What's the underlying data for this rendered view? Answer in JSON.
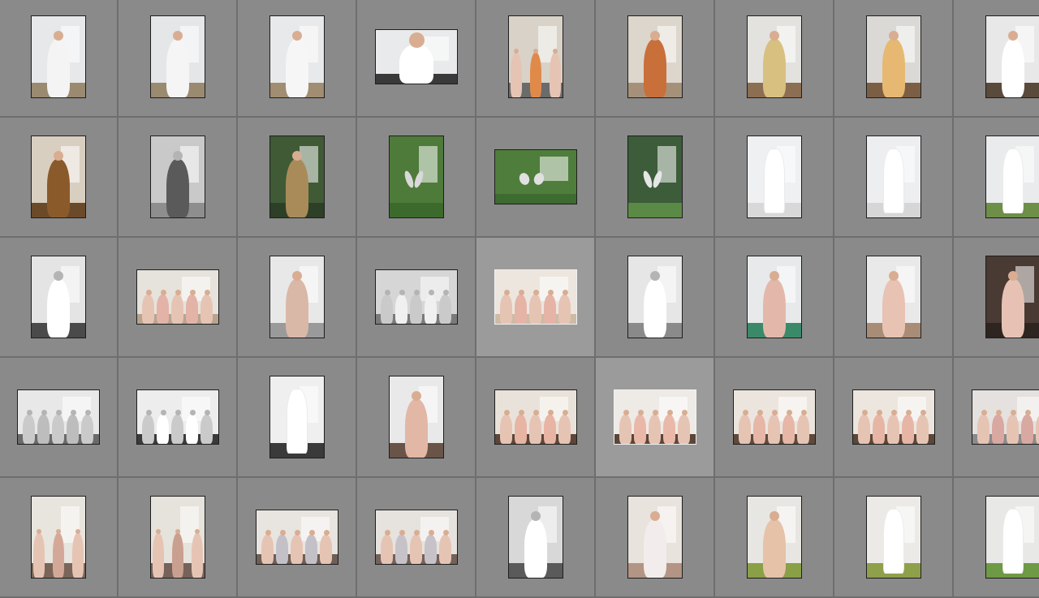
{
  "grid": {
    "rows": 5,
    "columns": 9,
    "selected": [
      [
        2,
        4
      ],
      [
        3,
        5
      ]
    ],
    "thumbnails": [
      [
        {
          "orient": "portrait",
          "bg": "#e6e8ea",
          "accent": "#f4f4f4",
          "floor": "#9a8a70",
          "tone": "color",
          "figure": "groom"
        },
        {
          "orient": "portrait",
          "bg": "#e4e6e8",
          "accent": "#f5f5f5",
          "floor": "#9a8a70",
          "tone": "color",
          "figure": "groom"
        },
        {
          "orient": "portrait",
          "bg": "#e8e9eb",
          "accent": "#f6f6f6",
          "floor": "#a08d72",
          "tone": "color",
          "figure": "groom"
        },
        {
          "orient": "landscape",
          "bg": "#e9eaec",
          "accent": "#ffffff",
          "floor": "#3a3a3a",
          "tone": "color",
          "figure": "groom"
        },
        {
          "orient": "portrait",
          "bg": "#d8d2c8",
          "accent": "#e08a4a",
          "floor": "#6b6b6b",
          "tone": "color",
          "figure": "group"
        },
        {
          "orient": "portrait",
          "bg": "#dcd6cc",
          "accent": "#c96f3a",
          "floor": "#a5917a",
          "tone": "color",
          "figure": "groom"
        },
        {
          "orient": "portrait",
          "bg": "#e3e2de",
          "accent": "#d8c080",
          "floor": "#8c6e52",
          "tone": "color",
          "figure": "groom"
        },
        {
          "orient": "portrait",
          "bg": "#dad9d6",
          "accent": "#e6b872",
          "floor": "#7c5e44",
          "tone": "color",
          "figure": "groom"
        },
        {
          "orient": "portrait",
          "bg": "#e8e8e8",
          "accent": "#ffffff",
          "floor": "#5a4a3c",
          "tone": "color",
          "figure": "groom"
        }
      ],
      [
        {
          "orient": "portrait",
          "bg": "#d9cfc0",
          "accent": "#8b5a2b",
          "floor": "#6b4a2a",
          "tone": "color",
          "figure": "groom"
        },
        {
          "orient": "portrait",
          "bg": "#c9c9c9",
          "accent": "#5a5a5a",
          "floor": "#8e8e8e",
          "tone": "bw",
          "figure": "groom"
        },
        {
          "orient": "portrait",
          "bg": "#3f5a35",
          "accent": "#a98b5a",
          "floor": "#2d3f26",
          "tone": "color",
          "figure": "groom"
        },
        {
          "orient": "portrait",
          "bg": "#4e7a3a",
          "accent": "#d9d9d9",
          "floor": "#3c6a2c",
          "tone": "color",
          "figure": "shoes"
        },
        {
          "orient": "landscape",
          "bg": "#4f7d3c",
          "accent": "#e0e0e0",
          "floor": "#3e6b2f",
          "tone": "color",
          "figure": "shoes"
        },
        {
          "orient": "portrait",
          "bg": "#3d5c3a",
          "accent": "#e6e6e6",
          "floor": "#5b8a46",
          "tone": "color",
          "figure": "shoes"
        },
        {
          "orient": "portrait",
          "bg": "#eef0f1",
          "accent": "#ffffff",
          "floor": "#d8d8d8",
          "tone": "color",
          "figure": "dress"
        },
        {
          "orient": "portrait",
          "bg": "#eceeef",
          "accent": "#ffffff",
          "floor": "#d6d6d6",
          "tone": "color",
          "figure": "dress"
        },
        {
          "orient": "portrait",
          "bg": "#e9ebec",
          "accent": "#ffffff",
          "floor": "#6d8f47",
          "tone": "color",
          "figure": "dress"
        }
      ],
      [
        {
          "orient": "portrait",
          "bg": "#e4e4e4",
          "accent": "#ffffff",
          "floor": "#4a4a4a",
          "tone": "bw",
          "figure": "bride"
        },
        {
          "orient": "landscape",
          "bg": "#e6e2dc",
          "accent": "#e3b3a8",
          "floor": "#b8a48e",
          "tone": "color",
          "figure": "group"
        },
        {
          "orient": "portrait",
          "bg": "#e8e8e8",
          "accent": "#d9b8a8",
          "floor": "#9a9a9a",
          "tone": "color",
          "figure": "bride"
        },
        {
          "orient": "landscape",
          "bg": "#d6d6d6",
          "accent": "#f0f0f0",
          "floor": "#7a7a7a",
          "tone": "bw",
          "figure": "group"
        },
        {
          "orient": "landscape",
          "bg": "#ece6df",
          "accent": "#e5b4a6",
          "floor": "#cdbba6",
          "tone": "color",
          "figure": "group"
        },
        {
          "orient": "portrait",
          "bg": "#e6e6e6",
          "accent": "#ffffff",
          "floor": "#8a8a8a",
          "tone": "bw",
          "figure": "bride"
        },
        {
          "orient": "portrait",
          "bg": "#e7e9ea",
          "accent": "#e3b8aa",
          "floor": "#3a8a6a",
          "tone": "color",
          "figure": "bride"
        },
        {
          "orient": "portrait",
          "bg": "#e9e9e9",
          "accent": "#e8c2b2",
          "floor": "#a88c76",
          "tone": "color",
          "figure": "bride"
        },
        {
          "orient": "portrait",
          "bg": "#4a3a34",
          "accent": "#e7c2b4",
          "floor": "#2e2420",
          "tone": "color",
          "figure": "bride"
        }
      ],
      [
        {
          "orient": "landscape",
          "bg": "#e8e8e8",
          "accent": "#bdbdbd",
          "floor": "#6a6a6a",
          "tone": "bw",
          "figure": "group"
        },
        {
          "orient": "landscape",
          "bg": "#ededed",
          "accent": "#ffffff",
          "floor": "#3a3a3a",
          "tone": "bw",
          "figure": "group"
        },
        {
          "orient": "portrait",
          "bg": "#efefef",
          "accent": "#ffffff",
          "floor": "#3a3a3a",
          "tone": "bw",
          "figure": "dress"
        },
        {
          "orient": "portrait",
          "bg": "#e9e9e9",
          "accent": "#e2b7a6",
          "floor": "#6a5448",
          "tone": "color",
          "figure": "bride"
        },
        {
          "orient": "landscape",
          "bg": "#e9e2da",
          "accent": "#e8b4a4",
          "floor": "#5c4638",
          "tone": "color",
          "figure": "group"
        },
        {
          "orient": "landscape",
          "bg": "#eeeae6",
          "accent": "#e9b8a8",
          "floor": "#5a4538",
          "tone": "color",
          "figure": "group"
        },
        {
          "orient": "landscape",
          "bg": "#ebe5de",
          "accent": "#e6b6a6",
          "floor": "#5e4a3c",
          "tone": "color",
          "figure": "group"
        },
        {
          "orient": "landscape",
          "bg": "#ece6df",
          "accent": "#e7b5a5",
          "floor": "#5b4739",
          "tone": "color",
          "figure": "group"
        },
        {
          "orient": "landscape",
          "bg": "#e4e1de",
          "accent": "#d9a8a0",
          "floor": "#8a8a8a",
          "tone": "color",
          "figure": "group"
        }
      ],
      [
        {
          "orient": "portrait",
          "bg": "#e8e4de",
          "accent": "#d4a898",
          "floor": "#7a6658",
          "tone": "color",
          "figure": "group"
        },
        {
          "orient": "portrait",
          "bg": "#e6e2dc",
          "accent": "#c9a090",
          "floor": "#76625a",
          "tone": "color",
          "figure": "group"
        },
        {
          "orient": "landscape",
          "bg": "#e8e4e0",
          "accent": "#c3c0c8",
          "floor": "#6e5e54",
          "tone": "color",
          "figure": "group"
        },
        {
          "orient": "landscape",
          "bg": "#e6e2de",
          "accent": "#c6c2c8",
          "floor": "#72625a",
          "tone": "color",
          "figure": "group"
        },
        {
          "orient": "portrait",
          "bg": "#d8d8d8",
          "accent": "#ffffff",
          "floor": "#5a5a5a",
          "tone": "bw",
          "figure": "bride"
        },
        {
          "orient": "portrait",
          "bg": "#e9e3dd",
          "accent": "#f2ecec",
          "floor": "#b49484",
          "tone": "color",
          "figure": "bride"
        },
        {
          "orient": "portrait",
          "bg": "#e8e6e2",
          "accent": "#e6c2a8",
          "floor": "#8aa046",
          "tone": "color",
          "figure": "bride"
        },
        {
          "orient": "portrait",
          "bg": "#eceae6",
          "accent": "#ffffff",
          "floor": "#8ea04a",
          "tone": "color",
          "figure": "dress"
        },
        {
          "orient": "portrait",
          "bg": "#e8e8e6",
          "accent": "#ffffff",
          "floor": "#6f9a45",
          "tone": "color",
          "figure": "dress"
        }
      ]
    ]
  }
}
